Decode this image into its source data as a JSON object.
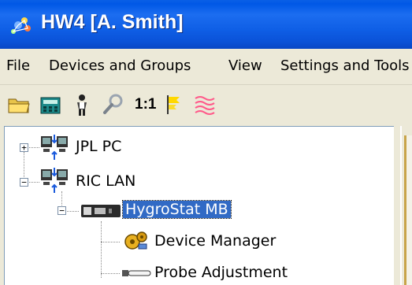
{
  "window": {
    "title": "HW4 [A. Smith]"
  },
  "menu": [
    {
      "label": "File"
    },
    {
      "label": "Devices and Groups"
    },
    {
      "label": "View"
    },
    {
      "label": "Settings and Tools"
    }
  ],
  "toolbar": {
    "scale_label": "1:1",
    "icons": [
      "open-folder-icon",
      "calculator-icon",
      "user-icon",
      "probe-search-icon",
      "scale-1-1",
      "flag-icon",
      "humidity-lines-icon"
    ]
  },
  "tree": {
    "nodes": [
      {
        "label": "JPL PC",
        "expander": "+",
        "icon": "network-computers-icon"
      },
      {
        "label": "RIC LAN",
        "expander": "−",
        "icon": "network-computers-icon"
      },
      {
        "label": "HygroStat MB",
        "expander": "−",
        "icon": "device-icon",
        "selected": true
      },
      {
        "label": "Device Manager",
        "icon": "gears-icon"
      },
      {
        "label": "Probe Adjustment",
        "icon": "probe-icon"
      }
    ]
  },
  "colors": {
    "titlebar": "#0058e6",
    "selection": "#316ac5",
    "chrome": "#ece9d8"
  }
}
